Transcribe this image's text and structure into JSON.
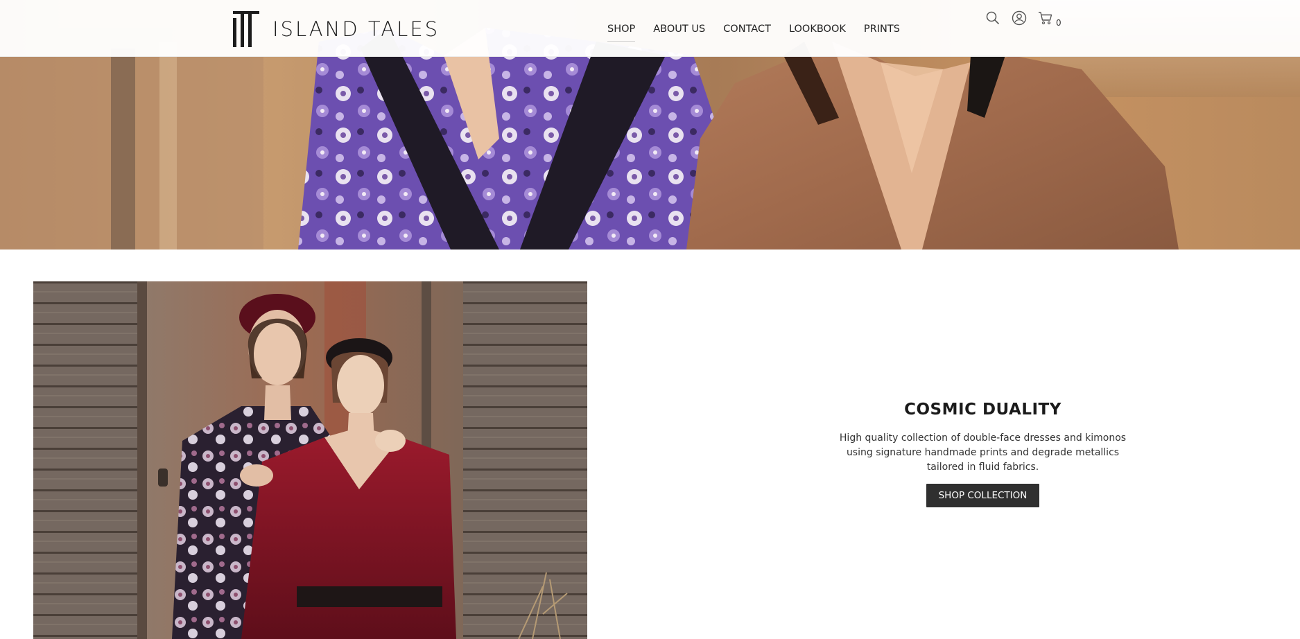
{
  "brand": {
    "name": "ISLAND TALES",
    "logo_icon": "it-monogram-icon"
  },
  "nav": {
    "items": [
      {
        "label": "SHOP",
        "active": true
      },
      {
        "label": "ABOUT US",
        "active": false
      },
      {
        "label": "CONTACT",
        "active": false
      },
      {
        "label": "LOOKBOOK",
        "active": false
      },
      {
        "label": "PRINTS",
        "active": false
      }
    ]
  },
  "header_icons": {
    "search": "search-icon",
    "account": "user-icon",
    "cart": "cart-icon",
    "cart_count": "0"
  },
  "collection": {
    "title": "COSMIC DUALITY",
    "description_lines": [
      "High quality collection of double-face dresses and kimonos",
      "using signature handmade prints and degrade metallics",
      "tailored in fluid fabrics."
    ],
    "button_label": "SHOP COLLECTION"
  },
  "colors": {
    "button_bg": "#2f2f2f",
    "text": "#1a1a1a"
  }
}
